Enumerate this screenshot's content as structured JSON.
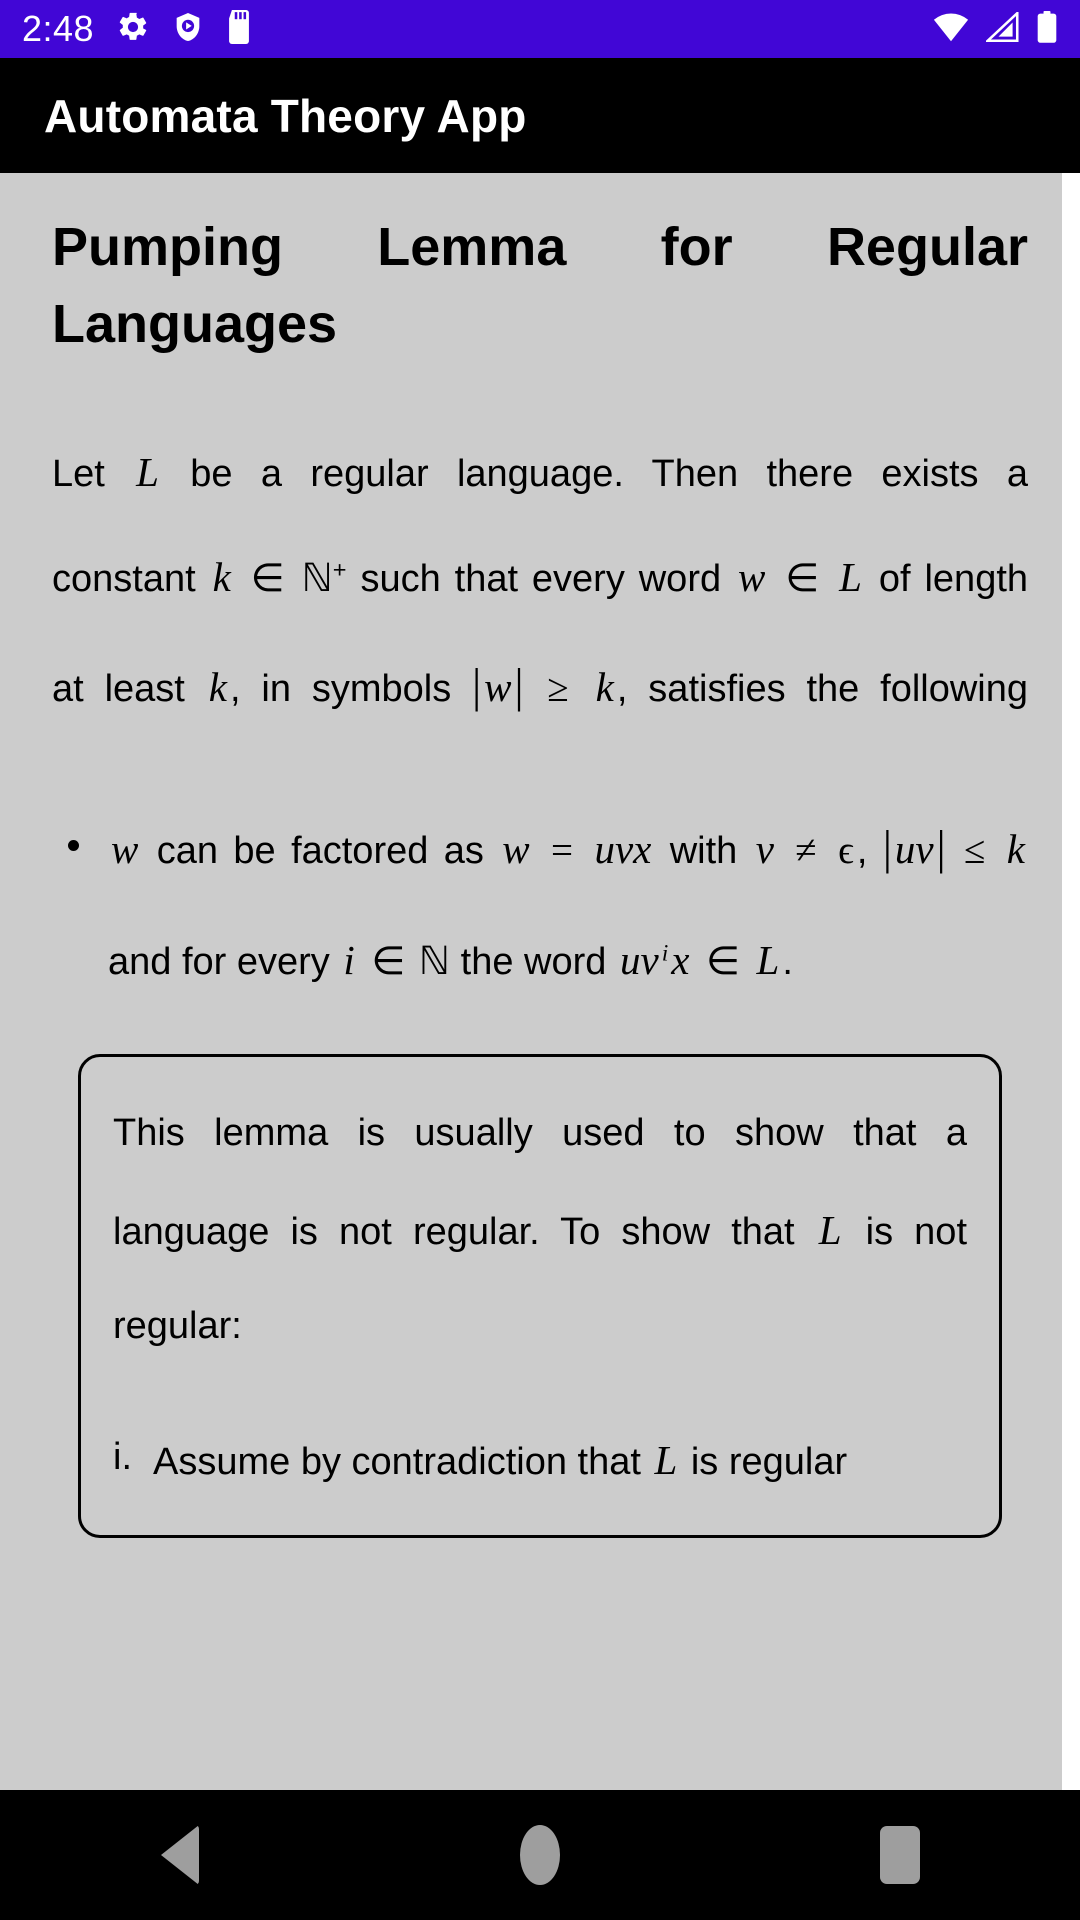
{
  "status_bar": {
    "time": "2:48",
    "background": "#4106d6",
    "icons": [
      "gear-icon",
      "play-protect-shield-icon",
      "sd-card-icon"
    ],
    "right_icons": [
      "wifi-icon",
      "cellular-signal-icon",
      "battery-icon"
    ]
  },
  "app_bar": {
    "title": "Automata Theory App",
    "background": "#000000"
  },
  "document": {
    "title_line1": "Pumping   Lemma   for   Regular",
    "title_line2": "Languages",
    "paragraph": {
      "p1": "Let",
      "m_L": "L",
      "p2": "be a regular language. Then there exists a constant",
      "m_k": "k",
      "m_in": "∈",
      "m_N": "ℕ",
      "m_plus": "+",
      "p3": "such that every word",
      "m_w": "w",
      "m_in2": "∈",
      "m_L2": "L",
      "p4": "of length at least",
      "m_k2": "k",
      "p5": ", in symbols",
      "m_absw": "w",
      "m_geq": "≥",
      "m_k3": "k",
      "p6": ", satisfies the following"
    },
    "bullet": {
      "m_w": "w",
      "t1": "can be factored as",
      "m_w2": "w",
      "m_eq": "=",
      "m_uvx": "uvx",
      "t2": "with",
      "m_v": "v",
      "m_neq": "≠",
      "m_eps": "ϵ",
      "t3": ",",
      "m_uv": "uv",
      "m_leq": "≤",
      "m_k": "k",
      "t4": "and for every",
      "m_i": "i",
      "m_in": "∈",
      "m_N": "ℕ",
      "t5": "the word",
      "m_uvix_u": "uv",
      "m_uvix_i": "i",
      "m_uvix_x": "x",
      "m_in2": "∈",
      "m_L": "L",
      "t6": "."
    },
    "callout": {
      "t1": "This lemma is usually used to show that a language is not regular. To show that",
      "m_L": "L",
      "t2": "is not regular:",
      "item1_marker": "i.",
      "item1_a": "Assume by contradiction that",
      "item1_m_L": "L",
      "item1_b": "is regular"
    }
  },
  "nav_bar": {
    "buttons": [
      "back-button",
      "home-button",
      "recents-button"
    ],
    "background": "#000000",
    "icon_color": "#9e9e9e"
  }
}
